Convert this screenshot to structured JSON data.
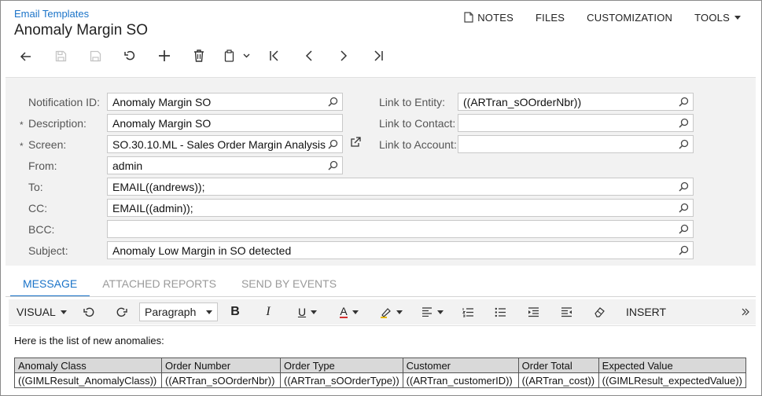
{
  "header": {
    "breadcrumb": "Email Templates",
    "title": "Anomaly Margin SO",
    "actions": {
      "notes": "NOTES",
      "files": "FILES",
      "customization": "CUSTOMIZATION",
      "tools": "TOOLS"
    }
  },
  "form": {
    "notification_id": {
      "label": "Notification ID:",
      "value": "Anomaly Margin SO"
    },
    "description": {
      "label": "Description:",
      "value": "Anomaly Margin SO"
    },
    "screen": {
      "label": "Screen:",
      "value": "SO.30.10.ML - Sales Order Margin Analysis"
    },
    "from": {
      "label": "From:",
      "value": "admin"
    },
    "to": {
      "label": "To:",
      "value": "EMAIL((andrews));"
    },
    "cc": {
      "label": "CC:",
      "value": "EMAIL((admin));"
    },
    "bcc": {
      "label": "BCC:",
      "value": ""
    },
    "subject": {
      "label": "Subject:",
      "value": "Anomaly Low Margin in SO detected"
    },
    "link_entity": {
      "label": "Link to Entity:",
      "value": "((ARTran_sOOrderNbr))"
    },
    "link_contact": {
      "label": "Link to Contact:",
      "value": ""
    },
    "link_account": {
      "label": "Link to Account:",
      "value": ""
    },
    "required_mark": "*"
  },
  "tabs": [
    {
      "label": "MESSAGE"
    },
    {
      "label": "ATTACHED REPORTS"
    },
    {
      "label": "SEND BY EVENTS"
    }
  ],
  "editor": {
    "mode": "VISUAL",
    "paragraph": "Paragraph",
    "insert": "INSERT",
    "bold": "B",
    "italic": "I",
    "underline": "U",
    "font_color": "A"
  },
  "body": {
    "intro": "Here is the list of new anomalies:",
    "table": {
      "headers": [
        "Anomaly Class",
        "Order Number",
        "Order Type",
        "Customer",
        "Order Total",
        "Expected Value"
      ],
      "row": [
        "((GIMLResult_AnomalyClass))",
        "((ARTran_sOOrderNbr))",
        "((ARTran_sOOrderType))",
        "((ARTran_customerID))",
        "((ARTran_cost))",
        "((GIMLResult_expectedValue))"
      ]
    }
  }
}
